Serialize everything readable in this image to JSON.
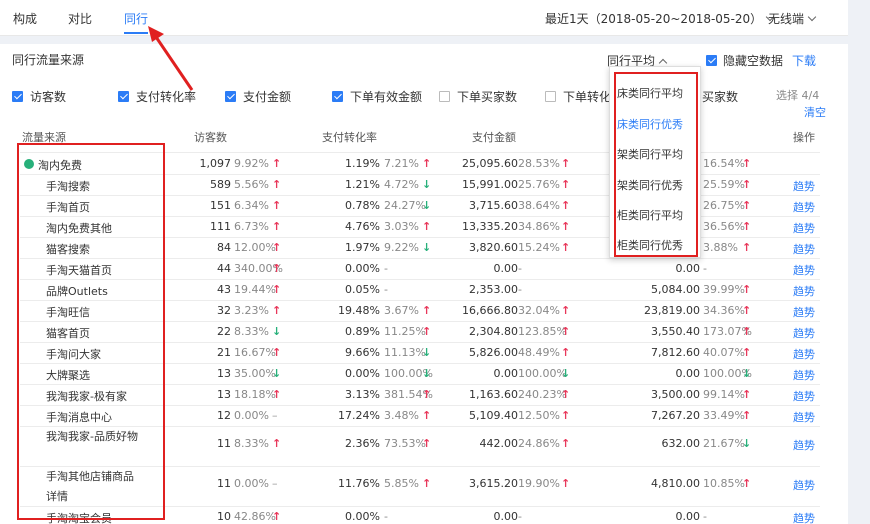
{
  "tabs": [
    "构成",
    "对比",
    "同行"
  ],
  "date_range": "最近1天（2018-05-20~2018-05-20）",
  "device": "无线端",
  "section_title": "同行流量来源",
  "rank_select": "同行平均",
  "hide_empty": "隐藏空数据",
  "download": "下载",
  "metrics": [
    {
      "label": "访客数",
      "checked": true
    },
    {
      "label": "支付转化率",
      "checked": true
    },
    {
      "label": "支付金额",
      "checked": true
    },
    {
      "label": "下单有效金额",
      "checked": true
    },
    {
      "label": "下单买家数",
      "checked": false
    },
    {
      "label": "下单转化",
      "checked": false
    }
  ],
  "hidden_metric": "买家数",
  "select_count": "选择 4/4",
  "clear": "清空",
  "headers": {
    "source": "流量来源",
    "visitors": "访客数",
    "conversion": "支付转化率",
    "payment": "支付金额",
    "action": "操作"
  },
  "dropdown": [
    {
      "label": "床类同行平均",
      "active": false
    },
    {
      "label": "床类同行优秀",
      "active": true
    },
    {
      "label": "架类同行平均",
      "active": false
    },
    {
      "label": "架类同行优秀",
      "active": false
    },
    {
      "label": "柜类同行平均",
      "active": false
    },
    {
      "label": "柜类同行优秀",
      "active": false
    }
  ],
  "trend_label": "趋势",
  "rows": [
    {
      "source": "淘内免费",
      "parent": true,
      "v": "1,097",
      "vp": "9.92%",
      "va": "up",
      "c": "1.19%",
      "cp": "7.21%",
      "ca": "up",
      "p": "25,095.60",
      "pp": "28.53%",
      "pa": "up",
      "o": "",
      "op": "16.54%",
      "oa": "up",
      "trend": false
    },
    {
      "source": "手淘搜索",
      "v": "589",
      "vp": "5.56%",
      "va": "up",
      "c": "1.21%",
      "cp": "4.72%",
      "ca": "down",
      "p": "15,991.00",
      "pp": "25.76%",
      "pa": "up",
      "o": "",
      "op": "25.59%",
      "oa": "up",
      "trend": true
    },
    {
      "source": "手淘首页",
      "v": "151",
      "vp": "6.34%",
      "va": "up",
      "c": "0.78%",
      "cp": "24.27%",
      "ca": "down",
      "p": "3,715.60",
      "pp": "38.64%",
      "pa": "up",
      "o": "",
      "op": "26.75%",
      "oa": "up",
      "trend": true
    },
    {
      "source": "淘内免费其他",
      "v": "111",
      "vp": "6.73%",
      "va": "up",
      "c": "4.76%",
      "cp": "3.03%",
      "ca": "up",
      "p": "13,335.20",
      "pp": "34.86%",
      "pa": "up",
      "o": "",
      "op": "36.56%",
      "oa": "up",
      "trend": true
    },
    {
      "source": "猫客搜索",
      "v": "84",
      "vp": "12.00%",
      "va": "up",
      "c": "1.97%",
      "cp": "9.22%",
      "ca": "down",
      "p": "3,820.60",
      "pp": "15.24%",
      "pa": "up",
      "o": "0.00",
      "op": "3.88%",
      "oa": "up",
      "trend": true
    },
    {
      "source": "手淘天猫首页",
      "v": "44",
      "vp": "340.00%",
      "va": "up",
      "c": "0.00%",
      "cp": "-",
      "ca": "none",
      "p": "0.00",
      "pp": "-",
      "pa": "none",
      "o": "0.00",
      "op": "-",
      "oa": "none",
      "trend": true
    },
    {
      "source": "品牌Outlets",
      "v": "43",
      "vp": "19.44%",
      "va": "up",
      "c": "0.05%",
      "cp": "-",
      "ca": "none",
      "p": "2,353.00",
      "pp": "-",
      "pa": "none",
      "o": "5,084.00",
      "op": "39.99%",
      "oa": "up",
      "trend": true
    },
    {
      "source": "手淘旺信",
      "v": "32",
      "vp": "3.23%",
      "va": "up",
      "c": "19.48%",
      "cp": "3.67%",
      "ca": "up",
      "p": "16,666.80",
      "pp": "32.04%",
      "pa": "up",
      "o": "23,819.00",
      "op": "34.36%",
      "oa": "up",
      "trend": true
    },
    {
      "source": "猫客首页",
      "v": "22",
      "vp": "8.33%",
      "va": "down",
      "c": "0.89%",
      "cp": "11.25%",
      "ca": "up",
      "p": "2,304.80",
      "pp": "123.85%",
      "pa": "up",
      "o": "3,550.40",
      "op": "173.07%",
      "oa": "up",
      "trend": true
    },
    {
      "source": "手淘问大家",
      "v": "21",
      "vp": "16.67%",
      "va": "up",
      "c": "9.66%",
      "cp": "11.13%",
      "ca": "down",
      "p": "5,826.00",
      "pp": "48.49%",
      "pa": "up",
      "o": "7,812.60",
      "op": "40.07%",
      "oa": "up",
      "trend": true
    },
    {
      "source": "大牌聚选",
      "v": "13",
      "vp": "35.00%",
      "va": "down",
      "c": "0.00%",
      "cp": "100.00%",
      "ca": "down",
      "p": "0.00",
      "pp": "100.00%",
      "pa": "down",
      "o": "0.00",
      "op": "100.00%",
      "oa": "down",
      "trend": true
    },
    {
      "source": "我淘我家-极有家",
      "v": "13",
      "vp": "18.18%",
      "va": "up",
      "c": "3.13%",
      "cp": "381.54%",
      "ca": "up",
      "p": "1,163.60",
      "pp": "240.23%",
      "pa": "up",
      "o": "3,500.00",
      "op": "99.14%",
      "oa": "up",
      "trend": true
    },
    {
      "source": "手淘消息中心",
      "v": "12",
      "vp": "0.00%",
      "va": "flat",
      "c": "17.24%",
      "cp": "3.48%",
      "ca": "up",
      "p": "5,109.40",
      "pp": "12.50%",
      "pa": "up",
      "o": "7,267.20",
      "op": "33.49%",
      "oa": "up",
      "trend": true
    },
    {
      "source": "我淘我家-品质好物",
      "wrap": true,
      "v": "11",
      "vp": "8.33%",
      "va": "up",
      "c": "2.36%",
      "cp": "73.53%",
      "ca": "up",
      "p": "442.00",
      "pp": "24.86%",
      "pa": "up",
      "o": "632.00",
      "op": "21.67%",
      "oa": "down",
      "trend": true
    },
    {
      "source": "手淘其他店铺商品详情",
      "wrap": true,
      "v": "11",
      "vp": "0.00%",
      "va": "flat",
      "c": "11.76%",
      "cp": "5.85%",
      "ca": "up",
      "p": "3,615.20",
      "pp": "19.90%",
      "pa": "up",
      "o": "4,810.00",
      "op": "10.85%",
      "oa": "up",
      "trend": true
    },
    {
      "source": "手淘淘宝会员",
      "v": "10",
      "vp": "42.86%",
      "va": "up",
      "c": "0.00%",
      "cp": "-",
      "ca": "none",
      "p": "0.00",
      "pp": "-",
      "pa": "none",
      "o": "0.00",
      "op": "-",
      "oa": "none",
      "trend": true
    }
  ]
}
